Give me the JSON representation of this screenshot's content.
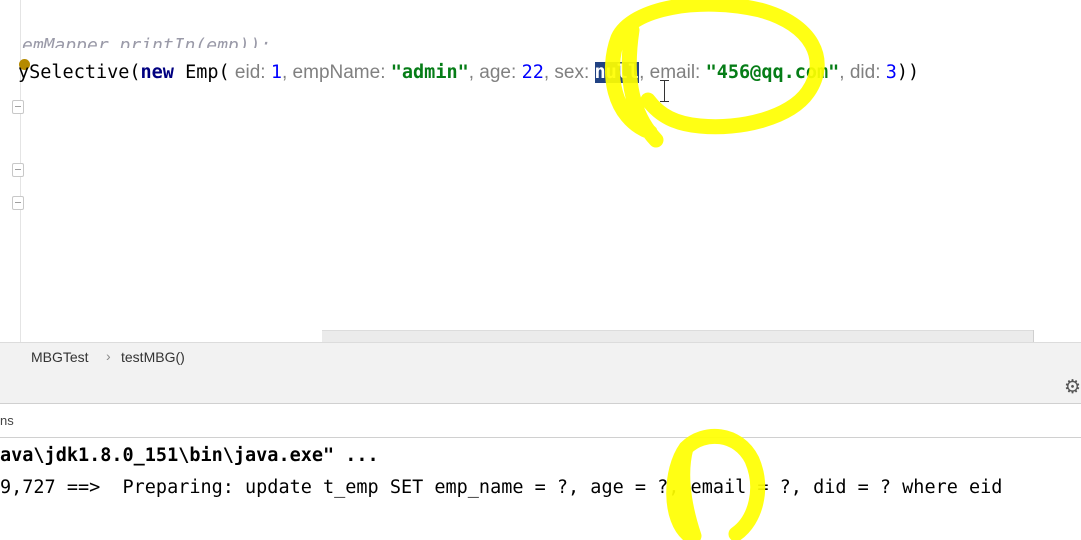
{
  "editor": {
    "faded_line": "emMapper.printIn(emp));",
    "code": {
      "method": "ySelective(",
      "kw_new": "new",
      "class_name": " Emp(",
      "hint_eid": " eid: ",
      "val_eid": "1",
      "hint_empName": ", empName: ",
      "val_empName": "\"admin\"",
      "hint_age": ", age: ",
      "val_age": "22",
      "hint_sex": ", sex: ",
      "val_sex": "null",
      "hint_email": ", email: ",
      "val_email": "\"456@qq.com\"",
      "hint_did": ", did: ",
      "val_did": "3",
      "close": "))"
    }
  },
  "breadcrumb": {
    "class_name": "MBGTest",
    "separator": "›",
    "method_name": "testMBG()"
  },
  "run_panel": {
    "tab_label": "ns",
    "gear_icon": "gear-icon"
  },
  "console": {
    "line1": "ava\\jdk1.8.0_151\\bin\\java.exe\" ...",
    "line2": "9,727 ==>  Preparing: update t_emp SET emp_name = ?, age = ?, email = ?, did = ? where eid"
  },
  "colors": {
    "keyword": "#000080",
    "string": "#067d17",
    "number": "#0000ff",
    "selection": "#214283",
    "highlighter": "#ffff00"
  }
}
